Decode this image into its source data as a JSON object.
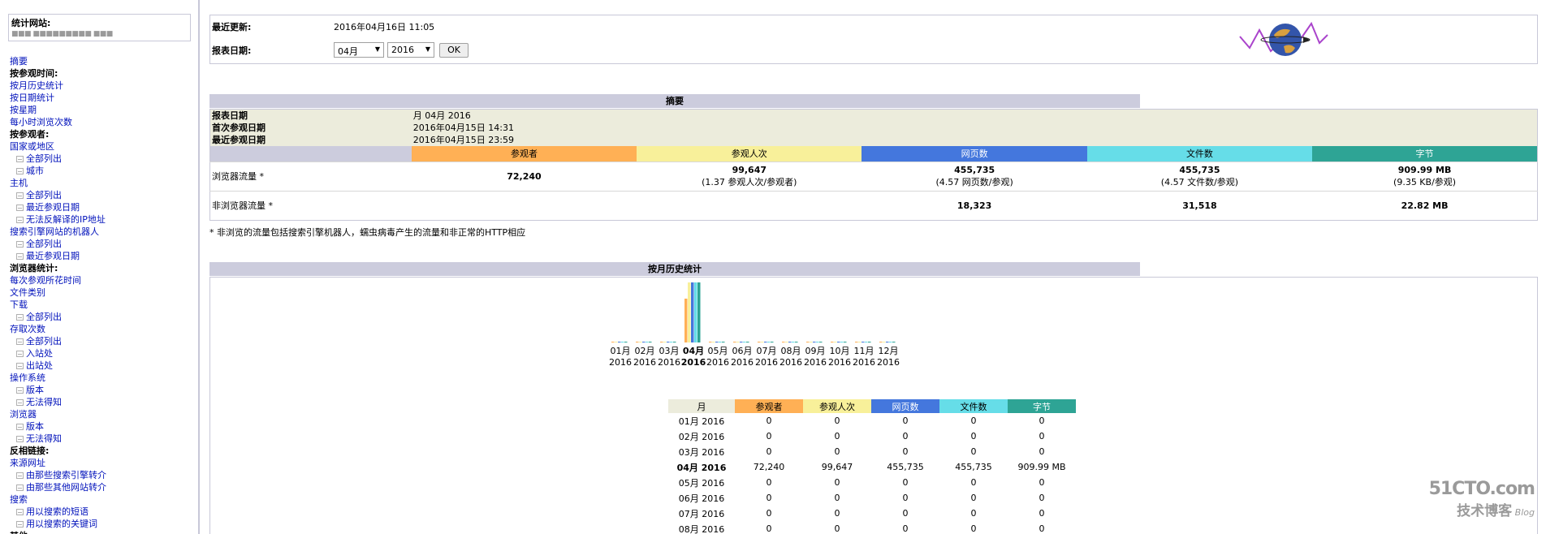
{
  "nav": {
    "site_label": "统计网站:",
    "site_value": "■■■ ■■■■■■■■■ ■■■",
    "items": [
      {
        "text": "摘要",
        "level": 1
      },
      {
        "text": "按参观时间:",
        "level": 0
      },
      {
        "text": "按月历史统计",
        "level": 1
      },
      {
        "text": "按日期统计",
        "level": 1
      },
      {
        "text": "按星期",
        "level": 1
      },
      {
        "text": "每小时浏览次数",
        "level": 1
      },
      {
        "text": "按参观者:",
        "level": 0
      },
      {
        "text": "国家或地区",
        "level": 1
      },
      {
        "text": "全部列出",
        "level": 2
      },
      {
        "text": "城市",
        "level": 2
      },
      {
        "text": "主机",
        "level": 1
      },
      {
        "text": "全部列出",
        "level": 2
      },
      {
        "text": "最近参观日期",
        "level": 2
      },
      {
        "text": "无法反解译的IP地址",
        "level": 2
      },
      {
        "text": "搜索引擎网站的机器人",
        "level": 1
      },
      {
        "text": "全部列出",
        "level": 2
      },
      {
        "text": "最近参观日期",
        "level": 2
      },
      {
        "text": "浏览器统计:",
        "level": 0
      },
      {
        "text": "每次参观所花时间",
        "level": 1
      },
      {
        "text": "文件类别",
        "level": 1
      },
      {
        "text": "下载",
        "level": 1
      },
      {
        "text": "全部列出",
        "level": 2
      },
      {
        "text": "存取次数",
        "level": 1
      },
      {
        "text": "全部列出",
        "level": 2
      },
      {
        "text": "入站处",
        "level": 2
      },
      {
        "text": "出站处",
        "level": 2
      },
      {
        "text": "操作系统",
        "level": 1
      },
      {
        "text": "版本",
        "level": 2
      },
      {
        "text": "无法得知",
        "level": 2
      },
      {
        "text": "浏览器",
        "level": 1
      },
      {
        "text": "版本",
        "level": 2
      },
      {
        "text": "无法得知",
        "level": 2
      },
      {
        "text": "反相链接:",
        "level": 0
      },
      {
        "text": "来源网址",
        "level": 1
      },
      {
        "text": "由那些搜索引擎转介",
        "level": 2
      },
      {
        "text": "由那些其他网站转介",
        "level": 2
      },
      {
        "text": "搜索",
        "level": 1
      },
      {
        "text": "用以搜索的短语",
        "level": 2
      },
      {
        "text": "用以搜索的关键词",
        "level": 2
      },
      {
        "text": "其他:",
        "level": 0
      }
    ]
  },
  "header": {
    "last_update_label": "最近更新:",
    "last_update_value": "2016年04月16日 11:05",
    "report_date_label": "报表日期:",
    "month_select": "04月",
    "year_select": "2016",
    "ok_label": "OK"
  },
  "summary": {
    "title": "摘要",
    "info_rows": [
      {
        "label": "报表日期",
        "value": "月 04月 2016"
      },
      {
        "label": "首次参观日期",
        "value": "2016年04月15日 14:31"
      },
      {
        "label": "最近参观日期",
        "value": "2016年04月15日 23:59"
      }
    ],
    "columns": [
      "参观者",
      "参观人次",
      "网页数",
      "文件数",
      "字节"
    ],
    "browser_label": "浏览器流量 *",
    "browser_values": [
      "72,240",
      "99,647",
      "455,735",
      "455,735",
      "909.99 MB"
    ],
    "browser_subs": [
      "",
      "(1.37 参观人次/参观者)",
      "(4.57 网页数/参观)",
      "(4.57 文件数/参观)",
      "(9.35 KB/参观)"
    ],
    "nonbrowser_label": "非浏览器流量 *",
    "nonbrowser_values": [
      "",
      "",
      "18,323",
      "31,518",
      "22.82 MB"
    ],
    "footnote": "* 非浏览的流量包括搜索引擎机器人，蠕虫病毒产生的流量和非正常的HTTP相应"
  },
  "history": {
    "title": "按月历史统计",
    "table_headers": [
      "月",
      "参观者",
      "参观人次",
      "网页数",
      "文件数",
      "字节"
    ],
    "rows": [
      {
        "month": "01月 2016",
        "v": [
          "0",
          "0",
          "0",
          "0",
          "0"
        ],
        "current": false
      },
      {
        "month": "02月 2016",
        "v": [
          "0",
          "0",
          "0",
          "0",
          "0"
        ],
        "current": false
      },
      {
        "month": "03月 2016",
        "v": [
          "0",
          "0",
          "0",
          "0",
          "0"
        ],
        "current": false
      },
      {
        "month": "04月 2016",
        "v": [
          "72,240",
          "99,647",
          "455,735",
          "455,735",
          "909.99 MB"
        ],
        "current": true
      },
      {
        "month": "05月 2016",
        "v": [
          "0",
          "0",
          "0",
          "0",
          "0"
        ],
        "current": false
      },
      {
        "month": "06月 2016",
        "v": [
          "0",
          "0",
          "0",
          "0",
          "0"
        ],
        "current": false
      },
      {
        "month": "07月 2016",
        "v": [
          "0",
          "0",
          "0",
          "0",
          "0"
        ],
        "current": false
      },
      {
        "month": "08月 2016",
        "v": [
          "0",
          "0",
          "0",
          "0",
          "0"
        ],
        "current": false
      }
    ]
  },
  "chart_data": {
    "type": "bar",
    "categories": [
      "01月",
      "02月",
      "03月",
      "04月",
      "05月",
      "06月",
      "07月",
      "08月",
      "09月",
      "10月",
      "11月",
      "12月"
    ],
    "category_years": [
      "2016",
      "2016",
      "2016",
      "2016",
      "2016",
      "2016",
      "2016",
      "2016",
      "2016",
      "2016",
      "2016",
      "2016"
    ],
    "highlight_category": "04月",
    "series": [
      {
        "name": "参观者",
        "color": "#ffb055",
        "values": [
          0,
          0,
          0,
          72240,
          0,
          0,
          0,
          0,
          0,
          0,
          0,
          0
        ]
      },
      {
        "name": "参观人次",
        "color": "#f8f09a",
        "values": [
          0,
          0,
          0,
          99647,
          0,
          0,
          0,
          0,
          0,
          0,
          0,
          0
        ]
      },
      {
        "name": "网页数",
        "color": "#4477dd",
        "values": [
          0,
          0,
          0,
          455735,
          0,
          0,
          0,
          0,
          0,
          0,
          0,
          0
        ]
      },
      {
        "name": "文件数",
        "color": "#66dde8",
        "values": [
          0,
          0,
          0,
          455735,
          0,
          0,
          0,
          0,
          0,
          0,
          0,
          0
        ]
      },
      {
        "name": "字节",
        "color": "#2ea495",
        "values": [
          0,
          0,
          0,
          909.99,
          0,
          0,
          0,
          0,
          0,
          0,
          0,
          0
        ]
      }
    ]
  },
  "watermark": {
    "line1": "51CTO.com",
    "line2": "技术博客",
    "line3": "Blog"
  }
}
